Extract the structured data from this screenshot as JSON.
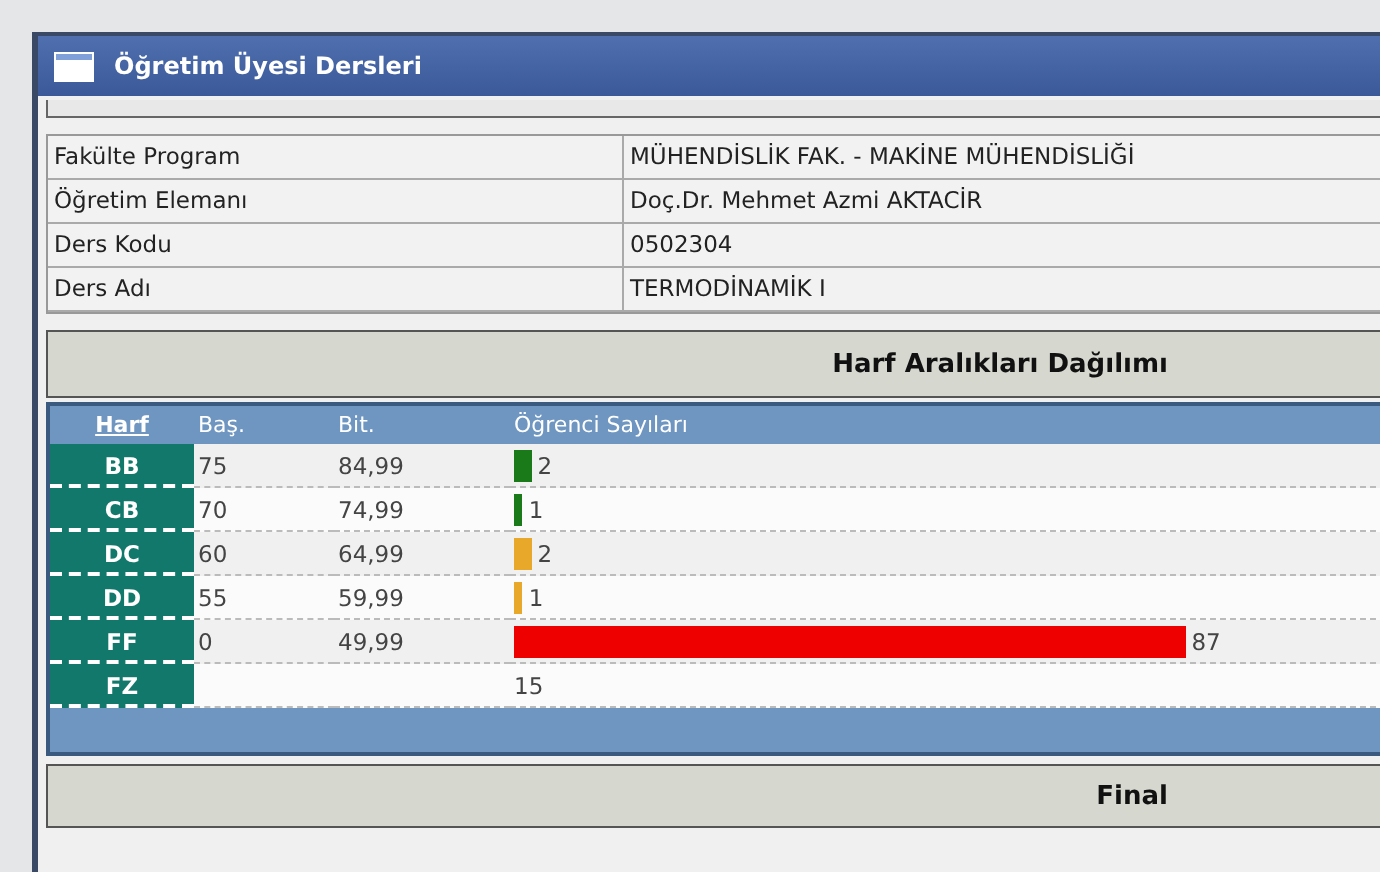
{
  "window": {
    "title": "Öğretim Üyesi Dersleri"
  },
  "info": [
    {
      "label": "Fakülte Program",
      "value": "MÜHENDİSLİK FAK. - MAKİNE MÜHENDİSLİĞİ"
    },
    {
      "label": "Öğretim Elemanı",
      "value": "Doç.Dr. Mehmet Azmi AKTACİR"
    },
    {
      "label": "Ders Kodu",
      "value": "0502304"
    },
    {
      "label": "Ders Adı",
      "value": "TERMODİNAMİK I"
    }
  ],
  "distribution": {
    "title": "Harf Aralıkları Dağılımı",
    "columns": [
      "Harf",
      "Baş.",
      "Bit.",
      "Öğrenci Sayıları"
    ],
    "rows": [
      {
        "grade": "BB",
        "start": "75",
        "end": "84,99",
        "count": "2",
        "level": 0.02,
        "color": "#1a7a1a"
      },
      {
        "grade": "CB",
        "start": "70",
        "end": "74,99",
        "count": "1",
        "level": 0.01,
        "color": "#1a7a1a"
      },
      {
        "grade": "DC",
        "start": "60",
        "end": "64,99",
        "count": "2",
        "level": 0.02,
        "color": "#e8a82a"
      },
      {
        "grade": "DD",
        "start": "55",
        "end": "59,99",
        "count": "1",
        "level": 0.01,
        "color": "#e8a82a"
      },
      {
        "grade": "FF",
        "start": "0",
        "end": "49,99",
        "count": "87",
        "level": 0.77,
        "color": "#ee0000"
      },
      {
        "grade": "FZ",
        "start": "",
        "end": "",
        "count": "15"
      }
    ]
  },
  "final": {
    "title": "Final"
  }
}
